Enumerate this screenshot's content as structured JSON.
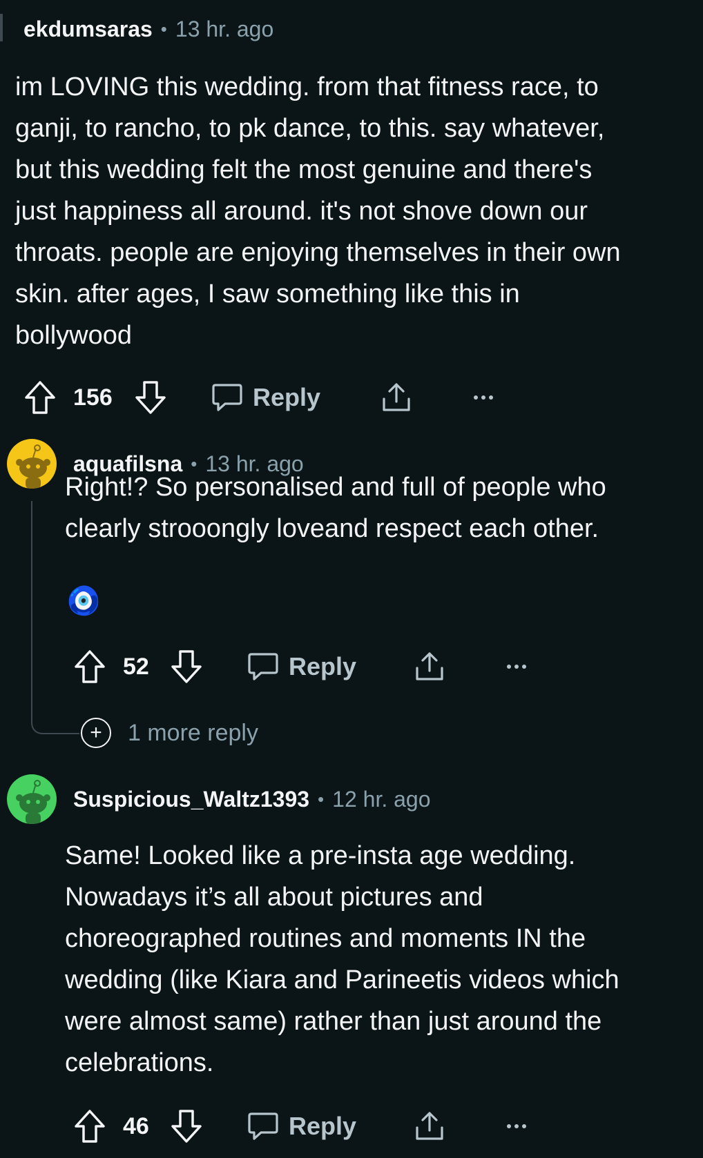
{
  "comments": [
    {
      "author": "ekdumsaras",
      "time": "13 hr. ago",
      "body": [
        "im LOVING this wedding. from that fitness race, to",
        "ganji, to rancho, to pk dance, to this. say whatever,",
        "but this wedding felt the most genuine and there's",
        "just happiness all around. it's not shove down our",
        "throats. people are enjoying themselves in their own",
        "skin. after ages, I saw something like this in",
        "bollywood"
      ],
      "votes": "156",
      "reply_label": "Reply"
    },
    {
      "author": "aquafilsna",
      "time": "13 hr. ago",
      "body": [
        "Right!? So personalised and full of people who",
        "clearly strooongly loveand respect each other."
      ],
      "emoji": "🧿",
      "votes": "52",
      "reply_label": "Reply",
      "more_replies": "1 more reply",
      "avatar_color": "#f5c518"
    },
    {
      "author": "Suspicious_Waltz1393",
      "time": "12 hr. ago",
      "body": [
        "Same! Looked like a pre-insta age wedding.",
        "Nowadays it’s all about pictures and",
        "choreographed routines and moments IN the",
        "wedding (like Kiara and Parineetis videos which",
        "were almost same) rather than just around the",
        "celebrations."
      ],
      "votes": "46",
      "reply_label": "Reply",
      "avatar_color": "#46d160"
    }
  ],
  "icons": {
    "upvote": "upvote-arrow-icon",
    "downvote": "downvote-arrow-icon",
    "reply": "speech-bubble-icon",
    "share": "share-upload-icon",
    "more": "ellipsis-icon",
    "expand": "plus-circle-icon",
    "avatar": "snoo-avatar-icon"
  },
  "colors": {
    "background": "#0b1416",
    "text": "#f2f4f5",
    "muted": "#8ba2ad",
    "thread_line": "#3e4a4f"
  }
}
